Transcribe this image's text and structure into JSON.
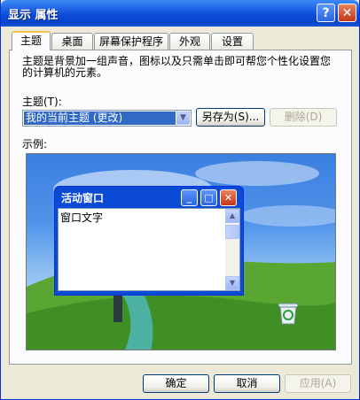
{
  "window": {
    "title": "显示 属性"
  },
  "titlebar": {
    "help_glyph": "?",
    "close_glyph": "✕"
  },
  "tabs": [
    {
      "label": "主题",
      "active": true
    },
    {
      "label": "桌面",
      "active": false
    },
    {
      "label": "屏幕保护程序",
      "active": false
    },
    {
      "label": "外观",
      "active": false
    },
    {
      "label": "设置",
      "active": false
    }
  ],
  "themes": {
    "description": "主题是背景加一组声音，图标以及只需单击即可帮您个性化设置您的计算机的元素。",
    "theme_label": "主题(T):",
    "theme_selected": "我的当前主题 (更改)",
    "save_as_label": "另存为(S)...",
    "delete_label": "删除(D)",
    "sample_label": "示例:"
  },
  "preview": {
    "active_window_title": "活动窗口",
    "window_text": "窗口文字"
  },
  "footer": {
    "ok_label": "确定",
    "cancel_label": "取消",
    "apply_label": "应用(A)"
  },
  "colors": {
    "titlebar": "#0a4ad6",
    "selection": "#316ac5",
    "close": "#c4381c",
    "tab_accent": "#f5c24a"
  }
}
